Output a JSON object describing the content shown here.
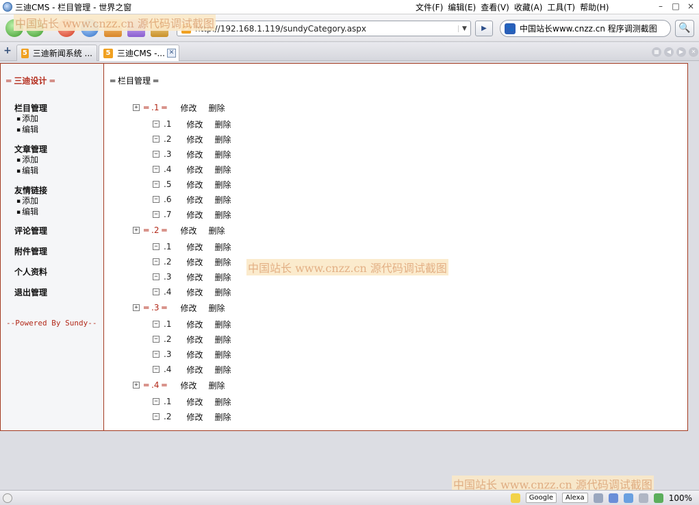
{
  "window": {
    "title": "三迪CMS - 栏目管理 - 世界之窗",
    "menu": [
      "文件(F)",
      "编辑(E)",
      "查看(V)",
      "收藏(A)",
      "工具(T)",
      "帮助(H)"
    ],
    "controls": {
      "minimize": "–",
      "restore": "□",
      "close": "×"
    }
  },
  "toolbar": {
    "address": "http://192.168.1.119/sundyCategory.aspx",
    "search_text": "中国站长www.cnzz.cn 程序调测截图",
    "go": "▶",
    "search_icon": "🔍"
  },
  "tabs": [
    {
      "label": "三迪新闻系统 ..."
    },
    {
      "label": "三迪CMS -..."
    }
  ],
  "sidebar": {
    "title": "═ 三迪设计 ═",
    "groups": [
      {
        "label": "栏目管理",
        "subs": [
          "添加",
          "编辑"
        ]
      },
      {
        "label": "文章管理",
        "subs": [
          "添加",
          "编辑"
        ]
      },
      {
        "label": "友情链接",
        "subs": [
          "添加",
          "编辑"
        ]
      },
      {
        "label": "评论管理",
        "subs": []
      },
      {
        "label": "附件管理",
        "subs": []
      },
      {
        "label": "个人资料",
        "subs": []
      },
      {
        "label": "退出管理",
        "subs": []
      }
    ],
    "powered": "--Powered By Sundy--"
  },
  "main": {
    "title": "═ 栏目管理 ═",
    "edit_label": "修改",
    "delete_label": "删除",
    "tree": [
      {
        "label": "═ .1 ═",
        "children": [
          ".1",
          ".2",
          ".3",
          ".4",
          ".5",
          ".6",
          ".7"
        ]
      },
      {
        "label": "═ .2 ═",
        "children": [
          ".1",
          ".2",
          ".3",
          ".4"
        ]
      },
      {
        "label": "═ .3 ═",
        "children": [
          ".1",
          ".2",
          ".3",
          ".4"
        ]
      },
      {
        "label": "═ .4 ═",
        "children": [
          ".1",
          ".2"
        ]
      }
    ]
  },
  "watermarks": {
    "top": "中国站长 www.cnzz.cn 源代码调试截图",
    "middle": "中国站长 www.cnzz.cn 源代码调试截图",
    "bottom": "中国站长 www.cnzz.cn 源代码调试截图"
  },
  "status": {
    "google": "Google",
    "alexa": "Alexa",
    "zoom": "100%"
  }
}
